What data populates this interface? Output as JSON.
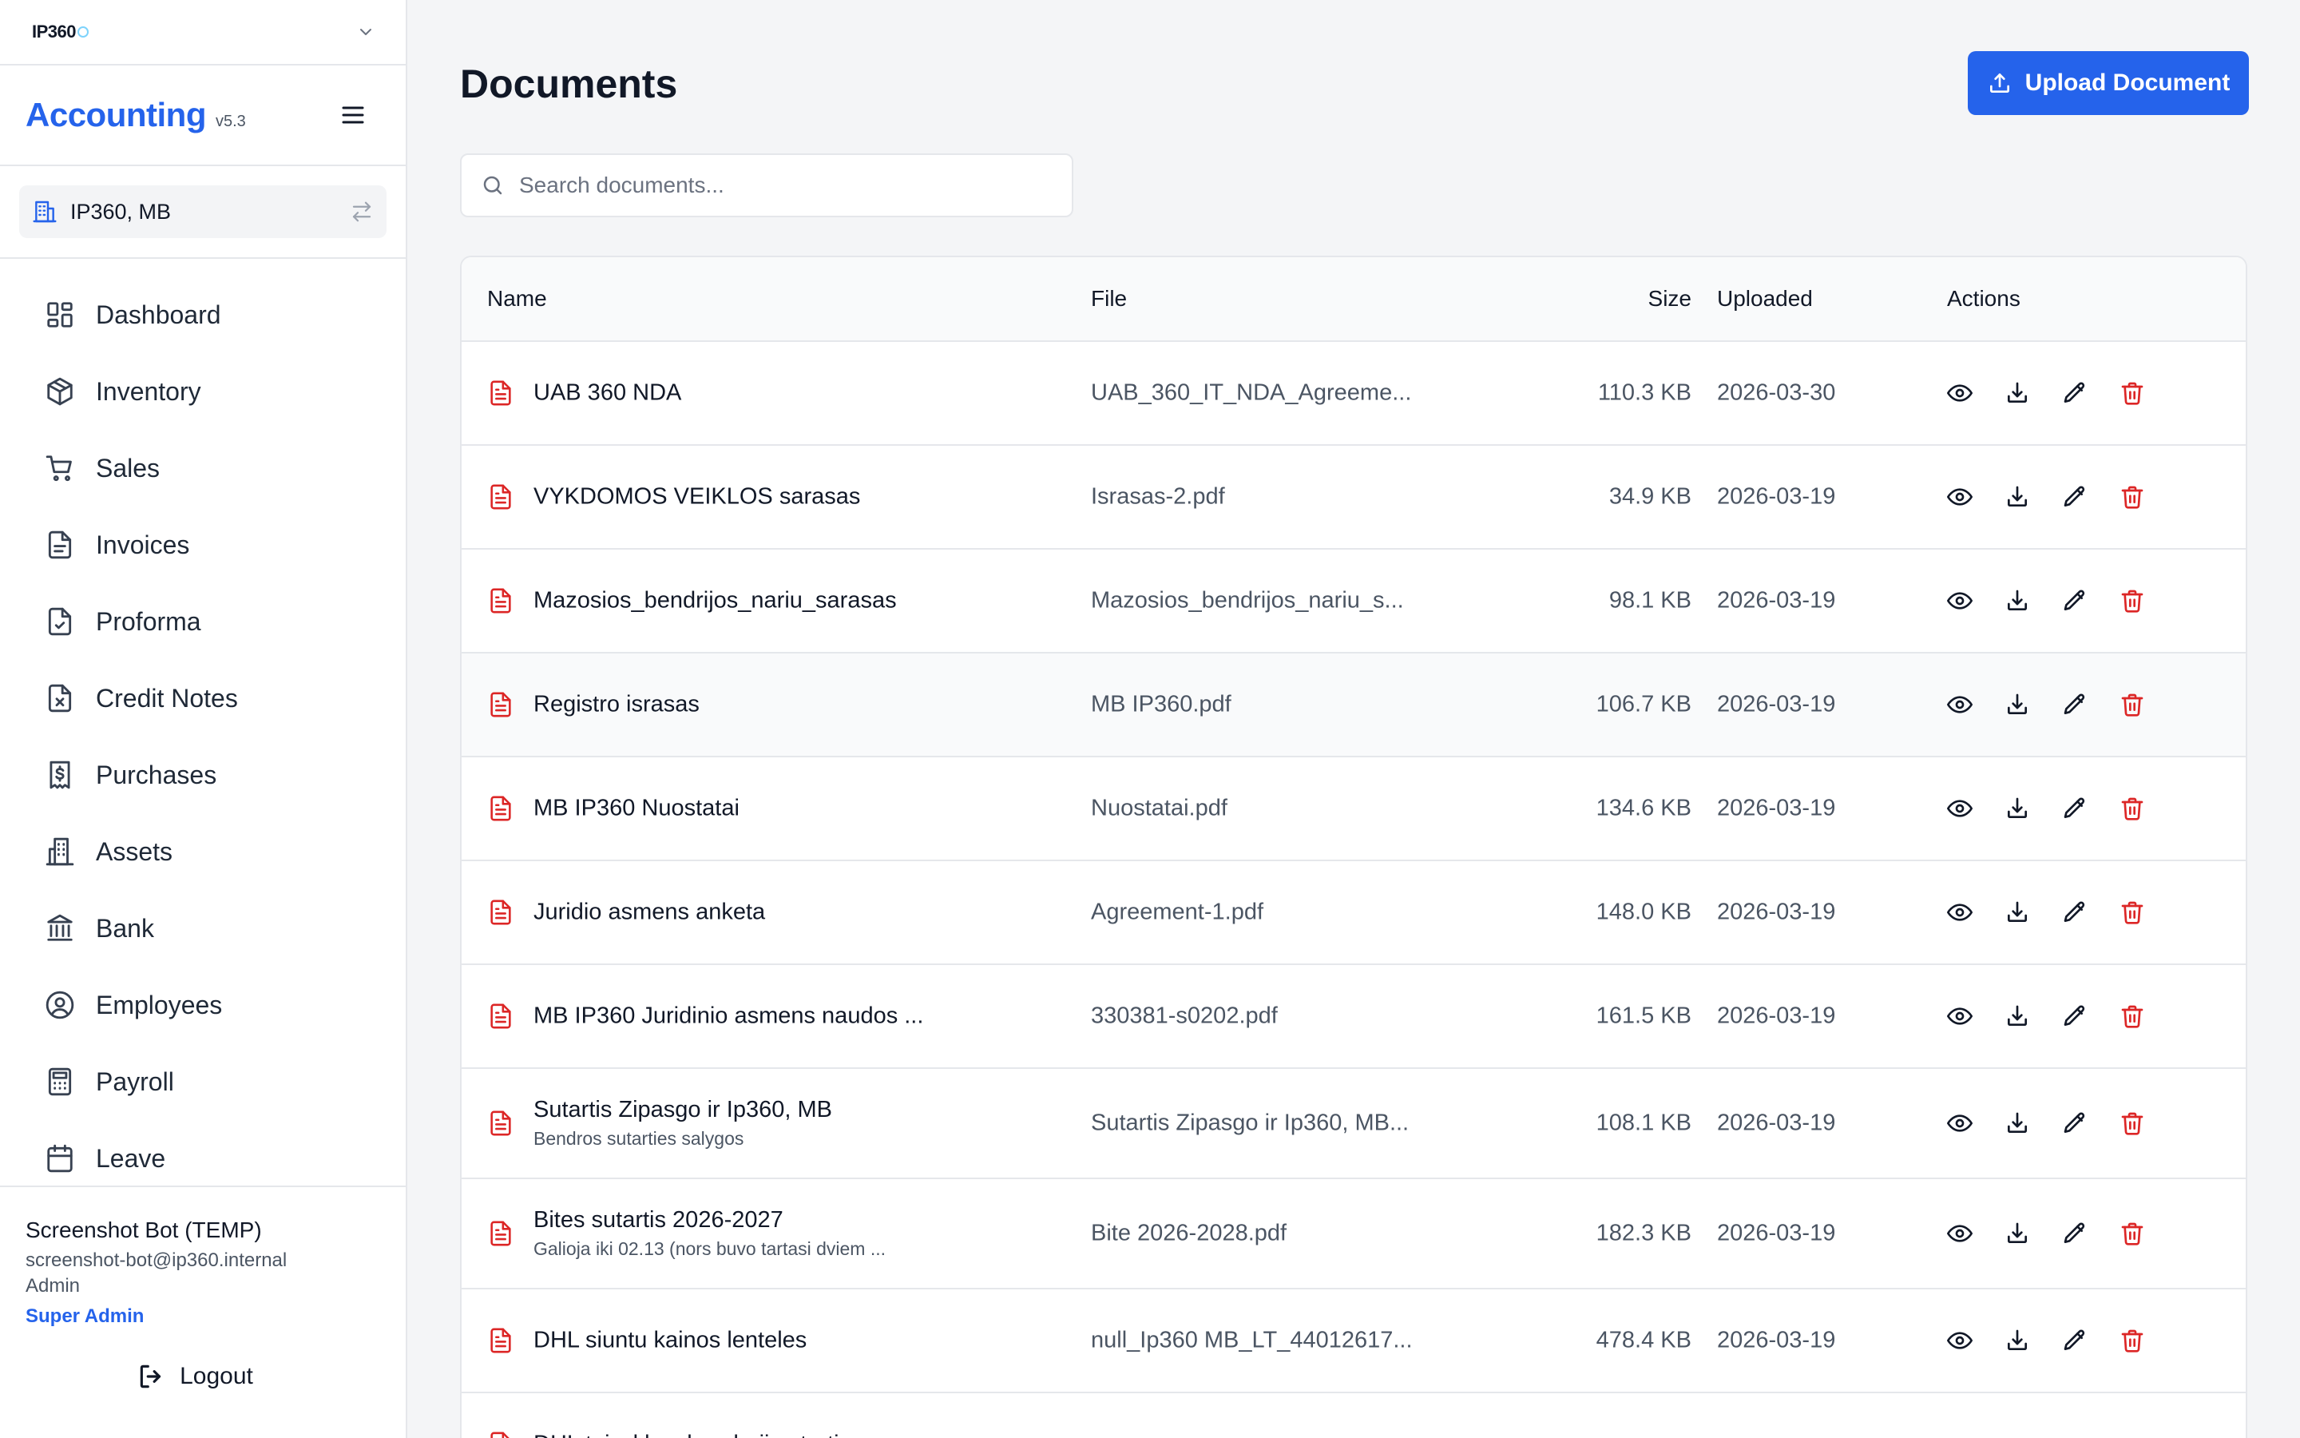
{
  "tenant": {
    "logo_main": "IP360",
    "logo_accent": ""
  },
  "brand": {
    "name": "Accounting",
    "version": "v5.3"
  },
  "company": {
    "name": "IP360, MB"
  },
  "nav": [
    {
      "key": "dashboard",
      "label": "Dashboard",
      "icon": "dashboard-icon"
    },
    {
      "key": "inventory",
      "label": "Inventory",
      "icon": "box-icon"
    },
    {
      "key": "sales",
      "label": "Sales",
      "icon": "cart-icon"
    },
    {
      "key": "invoices",
      "label": "Invoices",
      "icon": "document-icon"
    },
    {
      "key": "proforma",
      "label": "Proforma",
      "icon": "document-check-icon"
    },
    {
      "key": "credit-notes",
      "label": "Credit Notes",
      "icon": "document-x-icon"
    },
    {
      "key": "purchases",
      "label": "Purchases",
      "icon": "receipt-dollar-icon"
    },
    {
      "key": "assets",
      "label": "Assets",
      "icon": "buildings-icon"
    },
    {
      "key": "bank",
      "label": "Bank",
      "icon": "bank-icon"
    },
    {
      "key": "employees",
      "label": "Employees",
      "icon": "user-circle-icon"
    },
    {
      "key": "payroll",
      "label": "Payroll",
      "icon": "calculator-icon"
    },
    {
      "key": "leave",
      "label": "Leave",
      "icon": "calendar-icon"
    }
  ],
  "user": {
    "name": "Screenshot Bot (TEMP)",
    "email": "screenshot-bot@ip360.internal",
    "role": "Admin",
    "super": "Super Admin",
    "logout_label": "Logout"
  },
  "page": {
    "title": "Documents",
    "upload_label": "Upload Document",
    "search_placeholder": "Search documents..."
  },
  "table": {
    "headers": {
      "name": "Name",
      "file": "File",
      "size": "Size",
      "uploaded": "Uploaded",
      "actions": "Actions"
    },
    "rows": [
      {
        "title": "UAB 360 NDA",
        "desc": "",
        "file": "UAB_360_IT_NDA_Agreeme...",
        "size": "110.3 KB",
        "uploaded": "2026-03-30"
      },
      {
        "title": "VYKDOMOS VEIKLOS sarasas",
        "desc": "",
        "file": "Israsas-2.pdf",
        "size": "34.9 KB",
        "uploaded": "2026-03-19"
      },
      {
        "title": "Mazosios_bendrijos_nariu_sarasas",
        "desc": "",
        "file": "Mazosios_bendrijos_nariu_s...",
        "size": "98.1 KB",
        "uploaded": "2026-03-19"
      },
      {
        "title": "Registro israsas",
        "desc": "",
        "file": "MB IP360.pdf",
        "size": "106.7 KB",
        "uploaded": "2026-03-19"
      },
      {
        "title": "MB IP360 Nuostatai",
        "desc": "",
        "file": "Nuostatai.pdf",
        "size": "134.6 KB",
        "uploaded": "2026-03-19"
      },
      {
        "title": "Juridio asmens anketa",
        "desc": "",
        "file": "Agreement-1.pdf",
        "size": "148.0 KB",
        "uploaded": "2026-03-19"
      },
      {
        "title": "MB IP360 Juridinio asmens naudos ...",
        "desc": "",
        "file": "330381-s0202.pdf",
        "size": "161.5 KB",
        "uploaded": "2026-03-19"
      },
      {
        "title": "Sutartis Zipasgo ir Ip360, MB",
        "desc": "Bendros sutarties salygos",
        "file": "Sutartis Zipasgo ir Ip360, MB...",
        "size": "108.1 KB",
        "uploaded": "2026-03-19"
      },
      {
        "title": "Bites sutartis 2026-2027",
        "desc": "Galioja iki 02.13 (nors buvo tartasi dviem ...",
        "file": "Bite 2026-2028.pdf",
        "size": "182.3 KB",
        "uploaded": "2026-03-19"
      },
      {
        "title": "DHL siuntu kainos lenteles",
        "desc": "",
        "file": "null_Ip360 MB_LT_44012617...",
        "size": "478.4 KB",
        "uploaded": "2026-03-19"
      },
      {
        "title": "DHL taisykles, bendroji sutartis",
        "desc": "",
        "file": "",
        "size": "",
        "uploaded": ""
      }
    ]
  },
  "colors": {
    "accent": "#2563eb",
    "danger": "#dc2626",
    "pdf": "#dc2626"
  }
}
